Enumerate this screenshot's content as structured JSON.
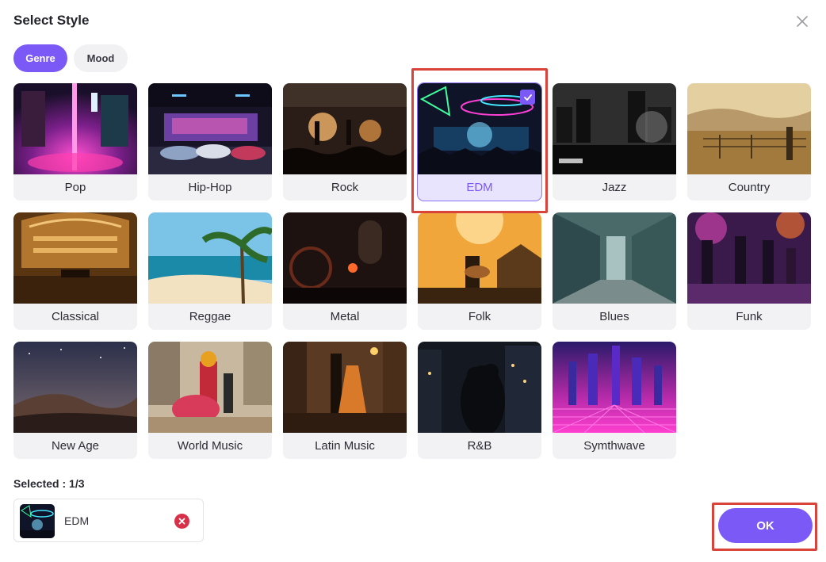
{
  "dialog": {
    "title": "Select Style"
  },
  "tabs": [
    {
      "label": "Genre",
      "active": true
    },
    {
      "label": "Mood",
      "active": false
    }
  ],
  "styles": [
    {
      "label": "Pop",
      "selected": false
    },
    {
      "label": "Hip-Hop",
      "selected": false
    },
    {
      "label": "Rock",
      "selected": false
    },
    {
      "label": "EDM",
      "selected": true
    },
    {
      "label": "Jazz",
      "selected": false
    },
    {
      "label": "Country",
      "selected": false
    },
    {
      "label": "Classical",
      "selected": false
    },
    {
      "label": "Reggae",
      "selected": false
    },
    {
      "label": "Metal",
      "selected": false
    },
    {
      "label": "Folk",
      "selected": false
    },
    {
      "label": "Blues",
      "selected": false
    },
    {
      "label": "Funk",
      "selected": false
    },
    {
      "label": "New Age",
      "selected": false
    },
    {
      "label": "World Music",
      "selected": false
    },
    {
      "label": "Latin Music",
      "selected": false
    },
    {
      "label": "R&B",
      "selected": false
    },
    {
      "label": "Symthwave",
      "selected": false
    }
  ],
  "selection": {
    "label": "Selected : 1/3",
    "items": [
      {
        "label": "EDM"
      }
    ]
  },
  "footer": {
    "ok_label": "OK"
  },
  "colors": {
    "accent": "#7b59f6",
    "highlight_box": "#d9443a",
    "remove": "#d9304a"
  }
}
